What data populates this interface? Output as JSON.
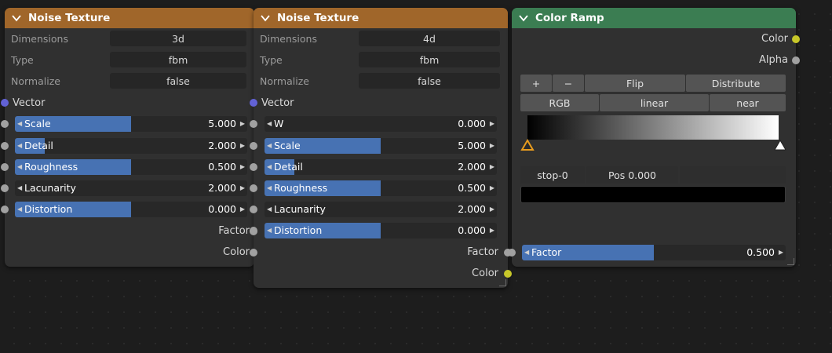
{
  "node1": {
    "title": "Noise Texture",
    "props": [
      {
        "label": "Dimensions",
        "value": "3d"
      },
      {
        "label": "Type",
        "value": "fbm"
      },
      {
        "label": "Normalize",
        "value": "false"
      }
    ],
    "vector_label": "Vector",
    "sliders": [
      {
        "label": "Scale",
        "value": "5.000",
        "fill": 0.5
      },
      {
        "label": "Detail",
        "value": "2.000",
        "fill": 0.13
      },
      {
        "label": "Roughness",
        "value": "0.500",
        "fill": 0.5
      },
      {
        "label": "Lacunarity",
        "value": "2.000",
        "fill": 0
      },
      {
        "label": "Distortion",
        "value": "0.000",
        "fill": 0.5
      }
    ],
    "outputs": {
      "factor": "Factor",
      "color": "Color"
    }
  },
  "node2": {
    "title": "Noise Texture",
    "props": [
      {
        "label": "Dimensions",
        "value": "4d"
      },
      {
        "label": "Type",
        "value": "fbm"
      },
      {
        "label": "Normalize",
        "value": "false"
      }
    ],
    "vector_label": "Vector",
    "sliders": [
      {
        "label": "W",
        "value": "0.000",
        "fill": 0
      },
      {
        "label": "Scale",
        "value": "5.000",
        "fill": 0.5
      },
      {
        "label": "Detail",
        "value": "2.000",
        "fill": 0.13
      },
      {
        "label": "Roughness",
        "value": "0.500",
        "fill": 0.5
      },
      {
        "label": "Lacunarity",
        "value": "2.000",
        "fill": 0
      },
      {
        "label": "Distortion",
        "value": "0.000",
        "fill": 0.5
      }
    ],
    "outputs": {
      "factor": "Factor",
      "color": "Color"
    }
  },
  "node3": {
    "title": "Color Ramp",
    "outputs": {
      "color": "Color",
      "alpha": "Alpha"
    },
    "toolbar": {
      "add": "+",
      "remove": "−",
      "flip": "Flip",
      "distribute": "Distribute"
    },
    "modes": {
      "color_mode": "RGB",
      "interpolation": "linear",
      "hue": "near"
    },
    "stop": {
      "index": "stop-0",
      "pos": "Pos 0.000"
    },
    "factor": {
      "label": "Factor",
      "value": "0.500",
      "fill": 0.5
    }
  },
  "colors": {
    "header_orange": "#a0662a",
    "header_green": "#3b7d52",
    "slider_fill": "#4772b3",
    "socket_vector": "#6262d6",
    "socket_float": "#a1a1a1",
    "socket_color": "#c7c729",
    "stop_active": "#e89c1e"
  }
}
